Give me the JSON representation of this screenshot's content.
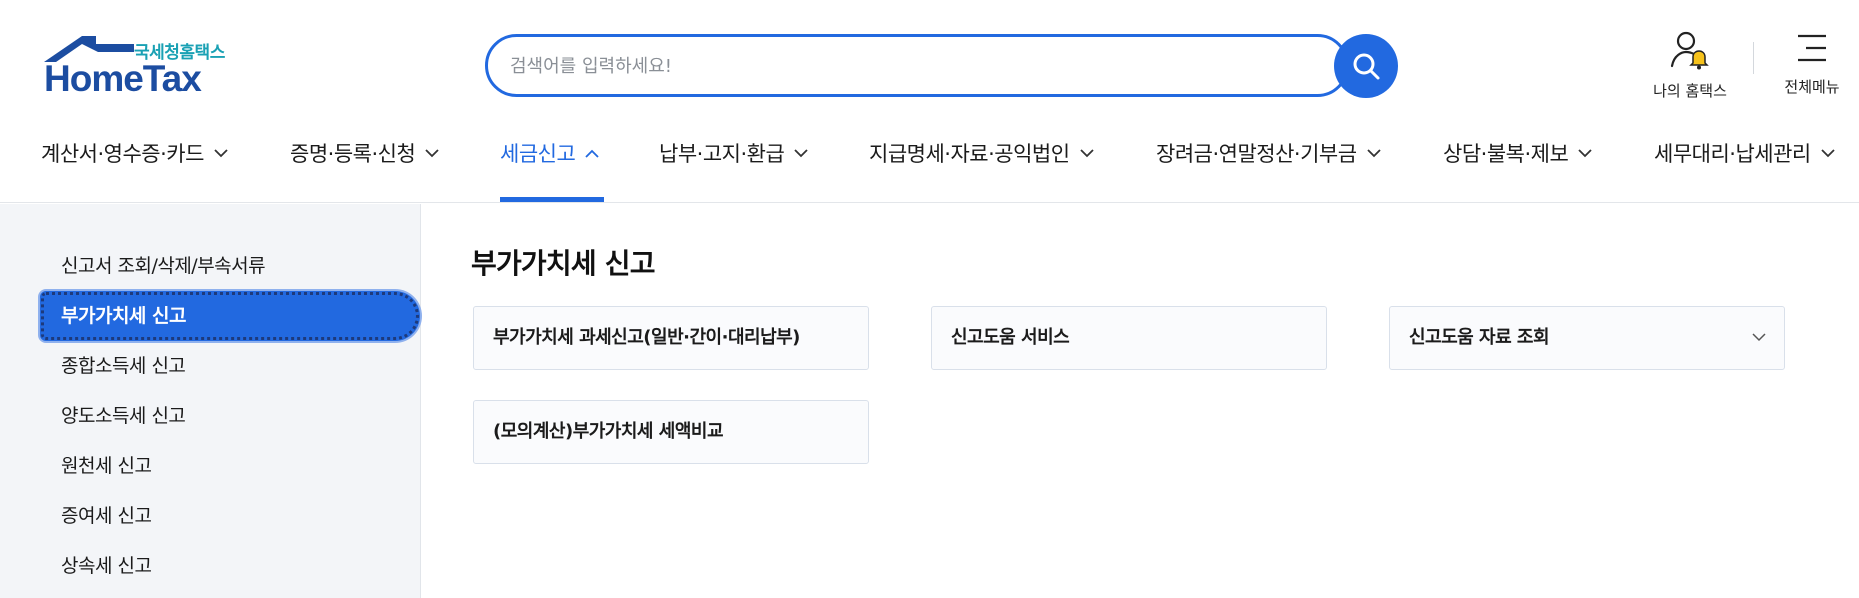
{
  "logo": {
    "sub": "국세청홈택스",
    "main": "HomeTax"
  },
  "search": {
    "placeholder": "검색어를 입력하세요!"
  },
  "utility": {
    "my_hometax": "나의 홈택스",
    "all_menu": "전체메뉴"
  },
  "gnb": [
    {
      "label": "계산서·영수증·카드",
      "active": false
    },
    {
      "label": "증명·등록·신청",
      "active": false
    },
    {
      "label": "세금신고",
      "active": true
    },
    {
      "label": "납부·고지·환급",
      "active": false
    },
    {
      "label": "지급명세·자료·공익법인",
      "active": false
    },
    {
      "label": "장려금·연말정산·기부금",
      "active": false
    },
    {
      "label": "상담·불복·제보",
      "active": false
    },
    {
      "label": "세무대리·납세관리",
      "active": false
    }
  ],
  "sidebar": {
    "items": [
      {
        "label": "신고서 조회/삭제/부속서류",
        "active": false
      },
      {
        "label": "부가가치세 신고",
        "active": true
      },
      {
        "label": "종합소득세 신고",
        "active": false
      },
      {
        "label": "양도소득세 신고",
        "active": false
      },
      {
        "label": "원천세 신고",
        "active": false
      },
      {
        "label": "증여세 신고",
        "active": false
      },
      {
        "label": "상속세 신고",
        "active": false
      }
    ]
  },
  "content": {
    "title": "부가가치세 신고",
    "cards": [
      {
        "label": "부가가치세 과세신고(일반·간이·대리납부)",
        "has_chevron": false
      },
      {
        "label": "신고도움 서비스",
        "has_chevron": false
      },
      {
        "label": "신고도움 자료 조회",
        "has_chevron": true
      },
      {
        "label": "(모의계산)부가가치세 세액비교",
        "has_chevron": false
      }
    ]
  },
  "colors": {
    "accent": "#2269e0",
    "logo_blue": "#1c4da1",
    "logo_teal": "#1aa1b4",
    "bell": "#f6c21b"
  }
}
